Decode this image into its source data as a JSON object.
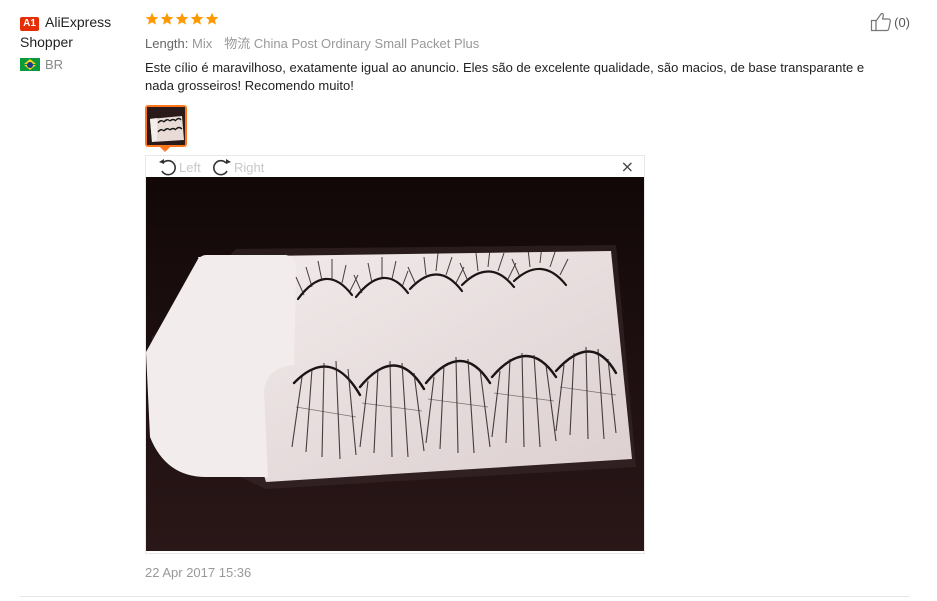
{
  "reviewer": {
    "level_badge": "A1",
    "name": "AliExpress Shopper",
    "country_code": "BR",
    "flag_icon": "brazil-flag-icon"
  },
  "review": {
    "rating": 5,
    "rating_max": 5,
    "star_color": "#ff9900",
    "length_label": "Length:",
    "length_value": "Mix",
    "logistics_label": "物流",
    "logistics_value": "China Post Ordinary Small Packet Plus",
    "text": "Este cílio é maravilhoso, exatamente igual ao anuncio. Eles são de excelente qualidade, são macios, de base transparante e nada grosseiros! Recomendo muito!",
    "date": "22 Apr 2017 15:36"
  },
  "helpful": {
    "icon": "thumbs-up-icon",
    "count_text": "(0)"
  },
  "viewer": {
    "rotate_left_label": "Left",
    "rotate_right_label": "Right",
    "close_label": "×",
    "accent_color": "#ff7519"
  }
}
